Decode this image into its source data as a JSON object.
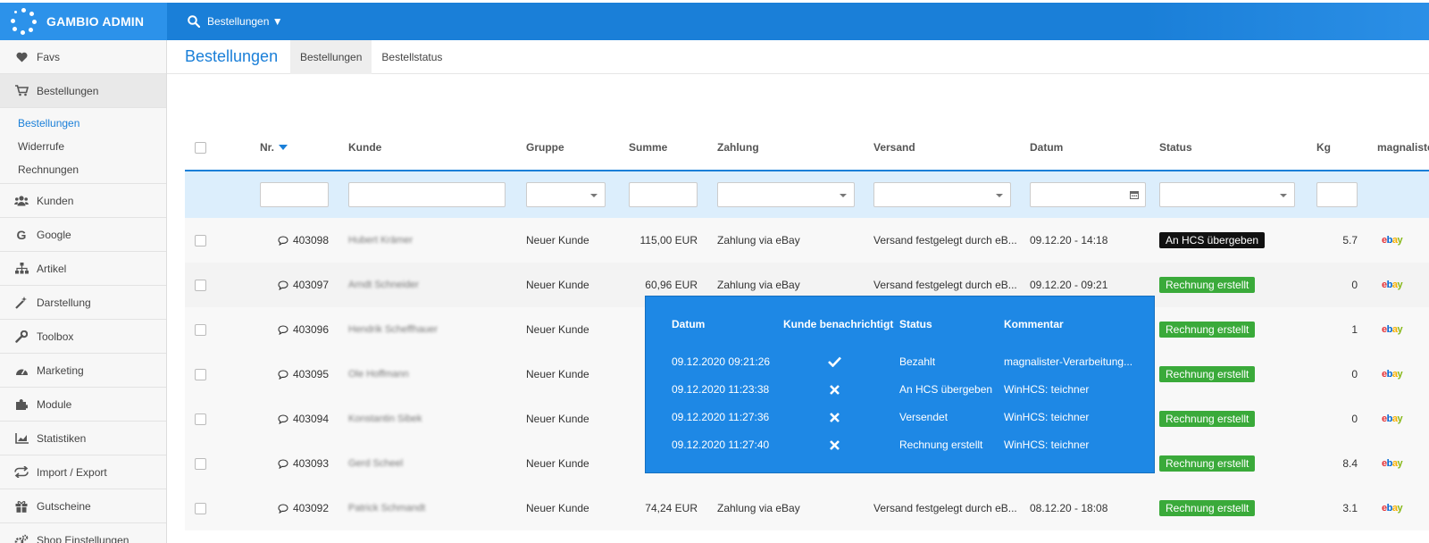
{
  "app": {
    "brand": "GAMBIO ADMIN",
    "search_label": "Bestellungen ▼"
  },
  "sidebar": {
    "items": [
      {
        "label": "Favs",
        "icon": "heart-icon"
      },
      {
        "label": "Bestellungen",
        "icon": "cart-icon"
      },
      {
        "label": "Kunden",
        "icon": "users-icon"
      },
      {
        "label": "Google",
        "icon": "google-icon"
      },
      {
        "label": "Artikel",
        "icon": "sitemap-icon"
      },
      {
        "label": "Darstellung",
        "icon": "magic-wand-icon"
      },
      {
        "label": "Toolbox",
        "icon": "wrench-icon"
      },
      {
        "label": "Marketing",
        "icon": "dashboard-icon"
      },
      {
        "label": "Module",
        "icon": "puzzle-icon"
      },
      {
        "label": "Statistiken",
        "icon": "chart-icon"
      },
      {
        "label": "Import / Export",
        "icon": "exchange-icon"
      },
      {
        "label": "Gutscheine",
        "icon": "gift-icon"
      },
      {
        "label": "Shop Einstellungen",
        "icon": "cogs-icon"
      }
    ],
    "subitems": [
      "Bestellungen",
      "Widerrufe",
      "Rechnungen"
    ]
  },
  "header": {
    "title": "Bestellungen",
    "tabs": [
      "Bestellungen",
      "Bestellstatus"
    ]
  },
  "table": {
    "columns": [
      "Nr.",
      "Kunde",
      "Gruppe",
      "Summe",
      "Zahlung",
      "Versand",
      "Datum",
      "Status",
      "Kg",
      "magnalister"
    ],
    "rows": [
      {
        "nr": "403098",
        "kunde": "Hubert Krämer",
        "gruppe": "Neuer Kunde",
        "summe": "115,00 EUR",
        "zahlung": "Zahlung via eBay",
        "versand": "Versand festgelegt durch eB...",
        "datum": "09.12.20 - 14:18",
        "status": "An HCS übergeben",
        "kg": "5.7"
      },
      {
        "nr": "403097",
        "kunde": "Arndt Schneider",
        "gruppe": "Neuer Kunde",
        "summe": "60,96 EUR",
        "zahlung": "Zahlung via eBay",
        "versand": "Versand festgelegt durch eB...",
        "datum": "09.12.20 - 09:21",
        "status": "Rechnung erstellt",
        "kg": "0"
      },
      {
        "nr": "403096",
        "kunde": "Hendrik Scheffhauer",
        "gruppe": "Neuer Kunde",
        "summe": "",
        "zahlung": "",
        "versand": "",
        "datum": "",
        "status": "Rechnung erstellt",
        "kg": "1"
      },
      {
        "nr": "403095",
        "kunde": "Ole Hoffmann",
        "gruppe": "Neuer Kunde",
        "summe": "",
        "zahlung": "",
        "versand": "",
        "datum": "",
        "status": "Rechnung erstellt",
        "kg": "0"
      },
      {
        "nr": "403094",
        "kunde": "Konstantin Sibek",
        "gruppe": "Neuer Kunde",
        "summe": "",
        "zahlung": "",
        "versand": "",
        "datum": "",
        "status": "Rechnung erstellt",
        "kg": "0"
      },
      {
        "nr": "403093",
        "kunde": "Gerd Scheel",
        "gruppe": "Neuer Kunde",
        "summe": "",
        "zahlung": "",
        "versand": "",
        "datum": "",
        "status": "Rechnung erstellt",
        "kg": "8.4"
      },
      {
        "nr": "403092",
        "kunde": "Patrick Schmandt",
        "gruppe": "Neuer Kunde",
        "summe": "74,24 EUR",
        "zahlung": "Zahlung via eBay",
        "versand": "Versand festgelegt durch eB...",
        "datum": "08.12.20 - 18:08",
        "status": "Rechnung erstellt",
        "kg": "3.1"
      }
    ]
  },
  "popup": {
    "headers": [
      "Datum",
      "Kunde benachrichtigt",
      "Status",
      "Kommentar"
    ],
    "rows": [
      {
        "datum": "09.12.2020 09:21:26",
        "notified": "check-icon",
        "status": "Bezahlt",
        "kommentar": "magnalister-Verarbeitung..."
      },
      {
        "datum": "09.12.2020 11:23:38",
        "notified": "x-icon",
        "status": "An HCS übergeben",
        "kommentar": "WinHCS: teichner"
      },
      {
        "datum": "09.12.2020 11:27:36",
        "notified": "x-icon",
        "status": "Versendet",
        "kommentar": "WinHCS: teichner"
      },
      {
        "datum": "09.12.2020 11:27:40",
        "notified": "x-icon",
        "status": "Rechnung erstellt",
        "kommentar": "WinHCS: teichner"
      }
    ]
  },
  "colors": {
    "primary": "#1a7fd8",
    "status_black": "#111111",
    "status_green": "#3aaa3a",
    "popup_bg": "#1e88e5"
  }
}
